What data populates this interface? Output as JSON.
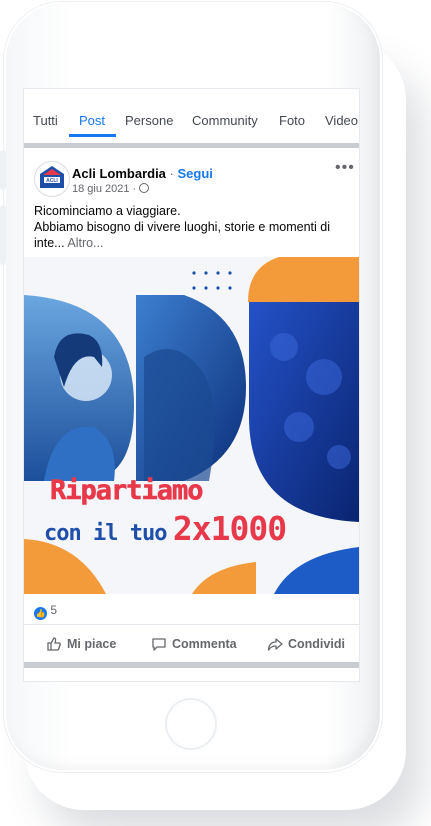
{
  "tabs": [
    {
      "label": "Tutti"
    },
    {
      "label": "Post"
    },
    {
      "label": "Persone"
    },
    {
      "label": "Community"
    },
    {
      "label": "Foto"
    },
    {
      "label": "Video"
    }
  ],
  "post": {
    "author": "Acli Lombardia",
    "separator": " · ",
    "follow_label": "Segui",
    "date": "18 giu 2021 ·",
    "text_line1": "Ricominciamo a viaggiare.",
    "text_line2": "Abbiamo bisogno di vivere luoghi, storie e momenti di",
    "text_line3": "inte... ",
    "more_label": "Altro...",
    "image": {
      "headline_line1": "Ripartiamo",
      "headline_line2a": "con il tuo",
      "headline_line2b": "2x1000"
    },
    "reaction_count": "5",
    "actions": {
      "like": "Mi piace",
      "comment": "Commenta",
      "share": "Condividi"
    }
  },
  "avatar_logo": "ACLI",
  "colors": {
    "accent": "#1877f2",
    "orange": "#f39a3b",
    "blue": "#1d5bc6",
    "headline_red": "#e8394a",
    "headline_blue": "#1f4fa8"
  }
}
